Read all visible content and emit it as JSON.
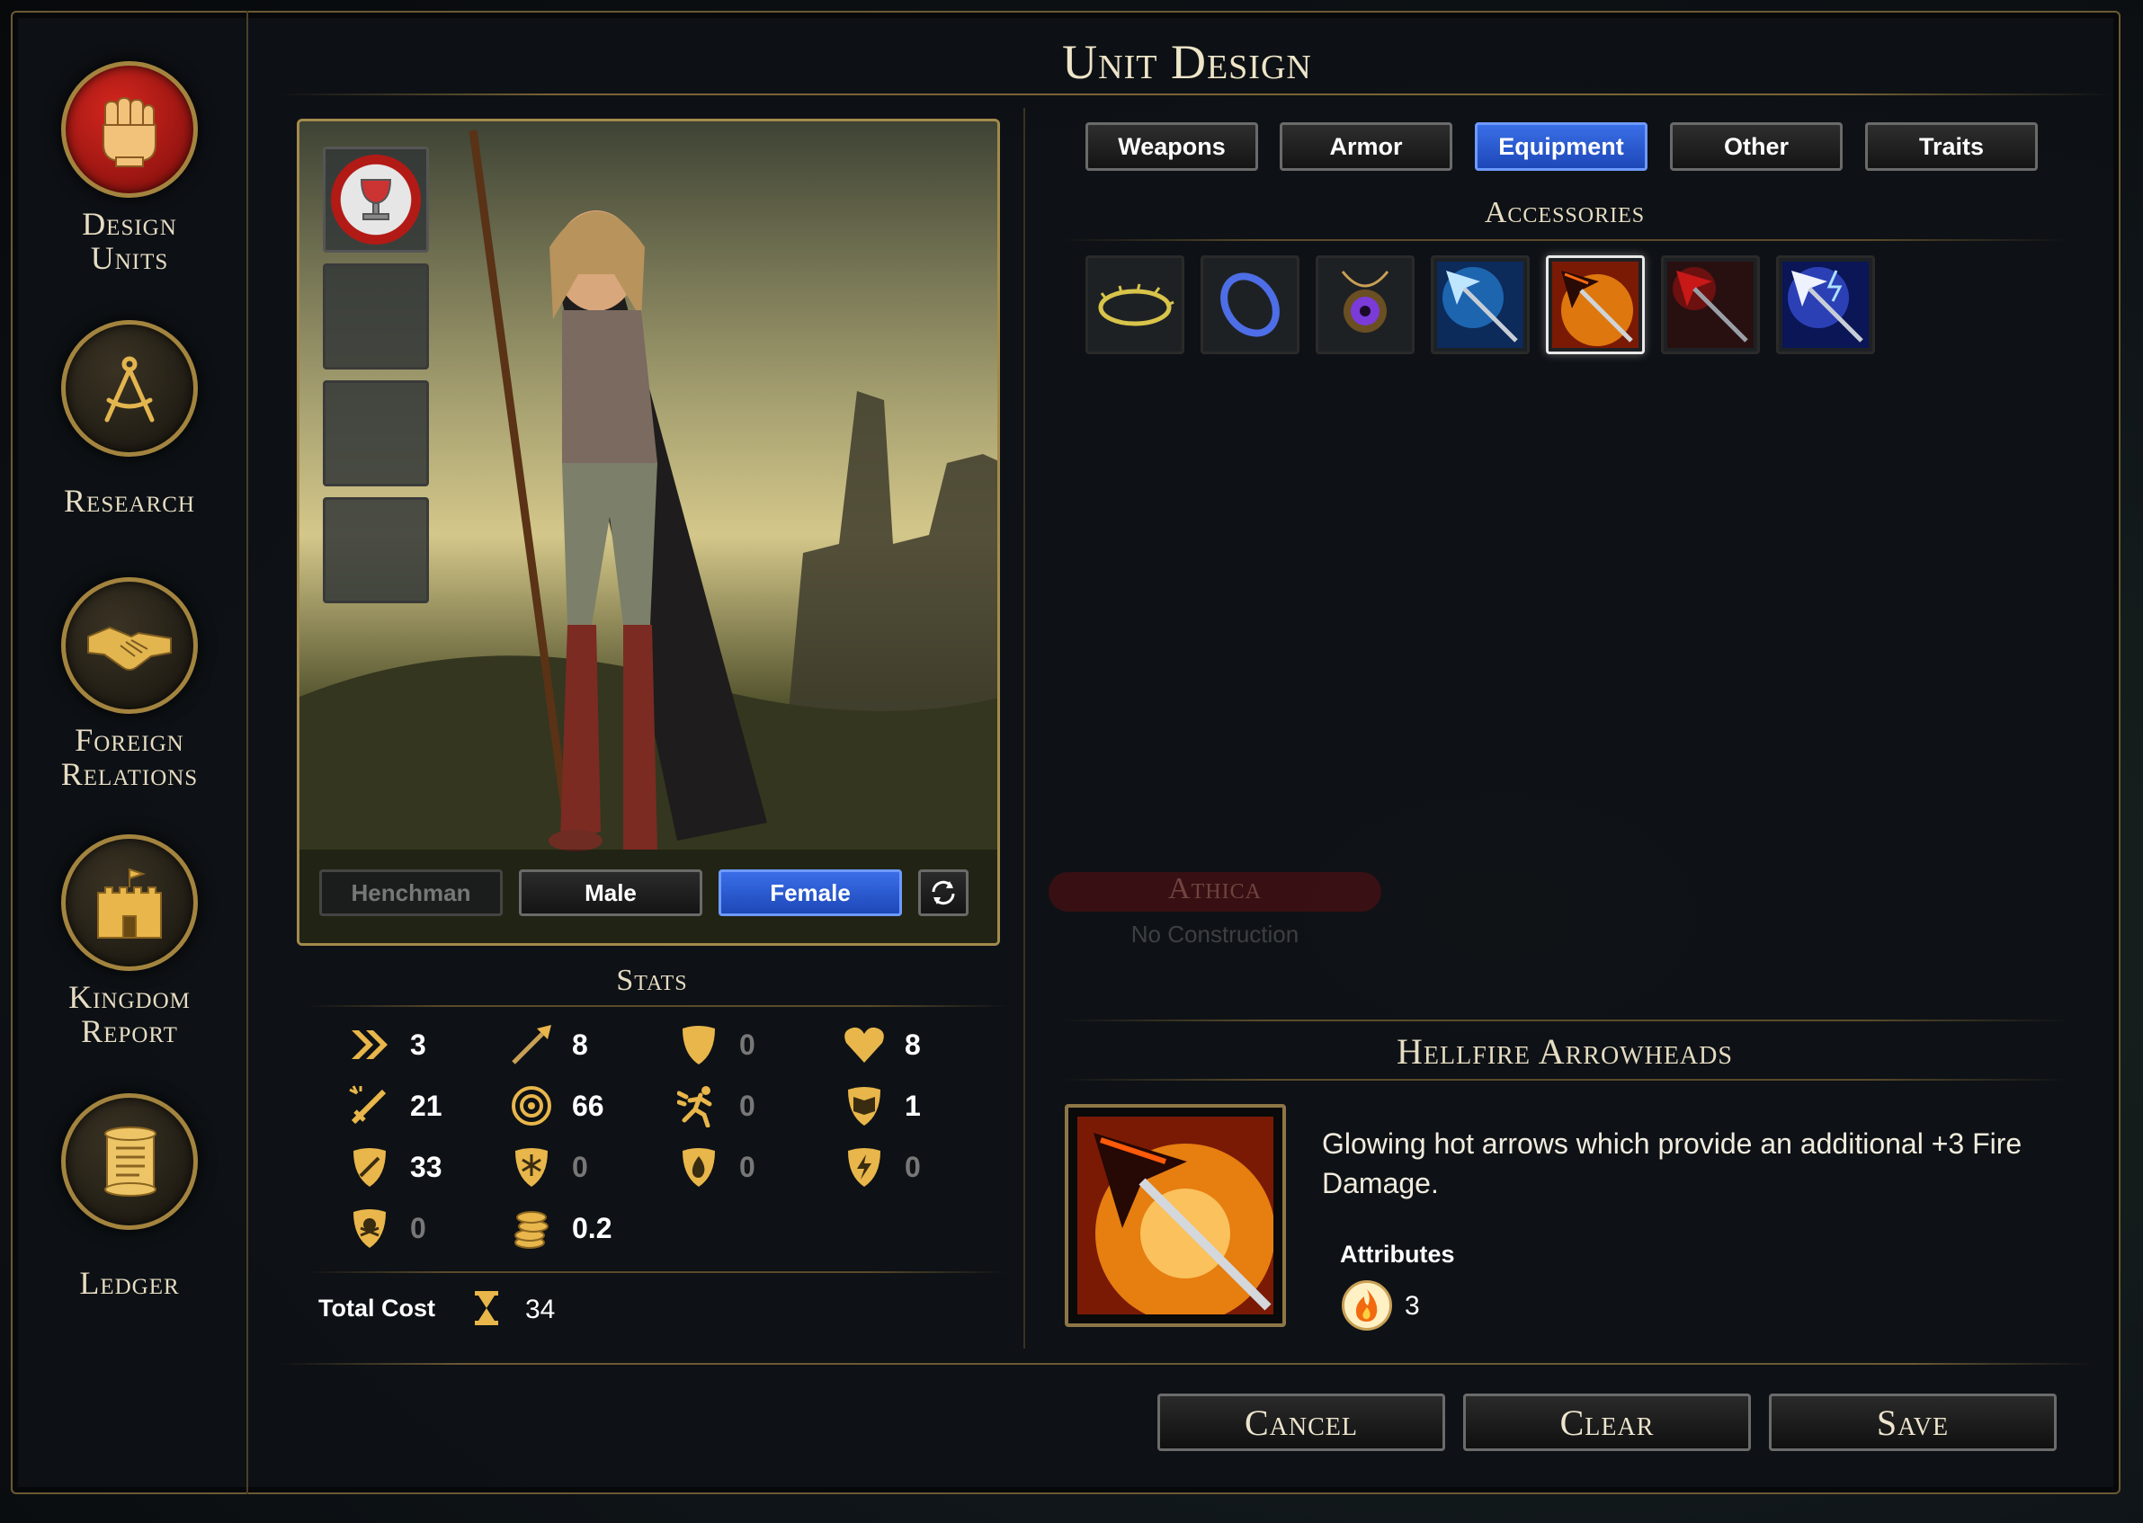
{
  "window": {
    "title": "Unit Design"
  },
  "sidebar": {
    "items": [
      {
        "label": "Design\nUnits",
        "icon": "fist-icon",
        "active": true
      },
      {
        "label": "Research",
        "icon": "compass-icon",
        "active": false
      },
      {
        "label": "Foreign\nRelations",
        "icon": "handshake-icon",
        "active": false
      },
      {
        "label": "Kingdom\nReport",
        "icon": "castle-icon",
        "active": false
      },
      {
        "label": "Ledger",
        "icon": "scroll-icon",
        "active": false
      }
    ]
  },
  "portrait": {
    "slots": [
      {
        "icon": "chalice-icon",
        "filled": true
      },
      {
        "filled": false
      },
      {
        "filled": false
      },
      {
        "filled": false
      }
    ],
    "buttons": {
      "henchman": "Henchman",
      "male": "Male",
      "female": "Female"
    },
    "selected": "Female"
  },
  "stats": {
    "title": "Stats",
    "items": [
      {
        "icon": "move-icon",
        "value": "3"
      },
      {
        "icon": "spear-icon",
        "value": "8"
      },
      {
        "icon": "shield-icon",
        "value": "0"
      },
      {
        "icon": "heart-icon",
        "value": "8"
      },
      {
        "icon": "sword-attack-icon",
        "value": "21"
      },
      {
        "icon": "target-icon",
        "value": "66"
      },
      {
        "icon": "dodge-icon",
        "value": "0"
      },
      {
        "icon": "spellbook-icon",
        "value": "1"
      },
      {
        "icon": "defense-shield-icon",
        "value": "33"
      },
      {
        "icon": "frost-shield-icon",
        "value": "0"
      },
      {
        "icon": "fire-shield-icon",
        "value": "0"
      },
      {
        "icon": "lightning-shield-icon",
        "value": "0"
      },
      {
        "icon": "poison-shield-icon",
        "value": "0"
      },
      {
        "icon": "gold-coins-icon",
        "value": "0.2"
      }
    ],
    "total_cost_label": "Total Cost",
    "total_cost_value": "34"
  },
  "tabs": [
    {
      "label": "Weapons",
      "active": false
    },
    {
      "label": "Armor",
      "active": false
    },
    {
      "label": "Equipment",
      "active": true
    },
    {
      "label": "Other",
      "active": false
    },
    {
      "label": "Traits",
      "active": false
    }
  ],
  "accessories": {
    "title": "Accessories",
    "items": [
      {
        "icon": "thorn-circlet-icon",
        "selected": false
      },
      {
        "icon": "ring-icon",
        "selected": false
      },
      {
        "icon": "amulet-icon",
        "selected": false
      },
      {
        "icon": "frost-arrowhead-icon",
        "selected": false
      },
      {
        "icon": "hellfire-arrowhead-icon",
        "selected": true
      },
      {
        "icon": "blood-arrowhead-icon",
        "selected": false
      },
      {
        "icon": "lightning-arrowhead-icon",
        "selected": false
      }
    ]
  },
  "map": {
    "city": "Athica",
    "status": "No Construction"
  },
  "detail": {
    "title": "Hellfire Arrowheads",
    "description": "Glowing hot arrows which provide an additional +3 Fire Damage.",
    "attributes_label": "Attributes",
    "attribute_value": "3",
    "attribute_icon": "fire-icon"
  },
  "footer": {
    "cancel": "Cancel",
    "clear": "Clear",
    "save": "Save"
  },
  "colors": {
    "gold": "#a3843f",
    "active_blue": "#2a5bd7",
    "panel_bg": "#0e1116"
  }
}
